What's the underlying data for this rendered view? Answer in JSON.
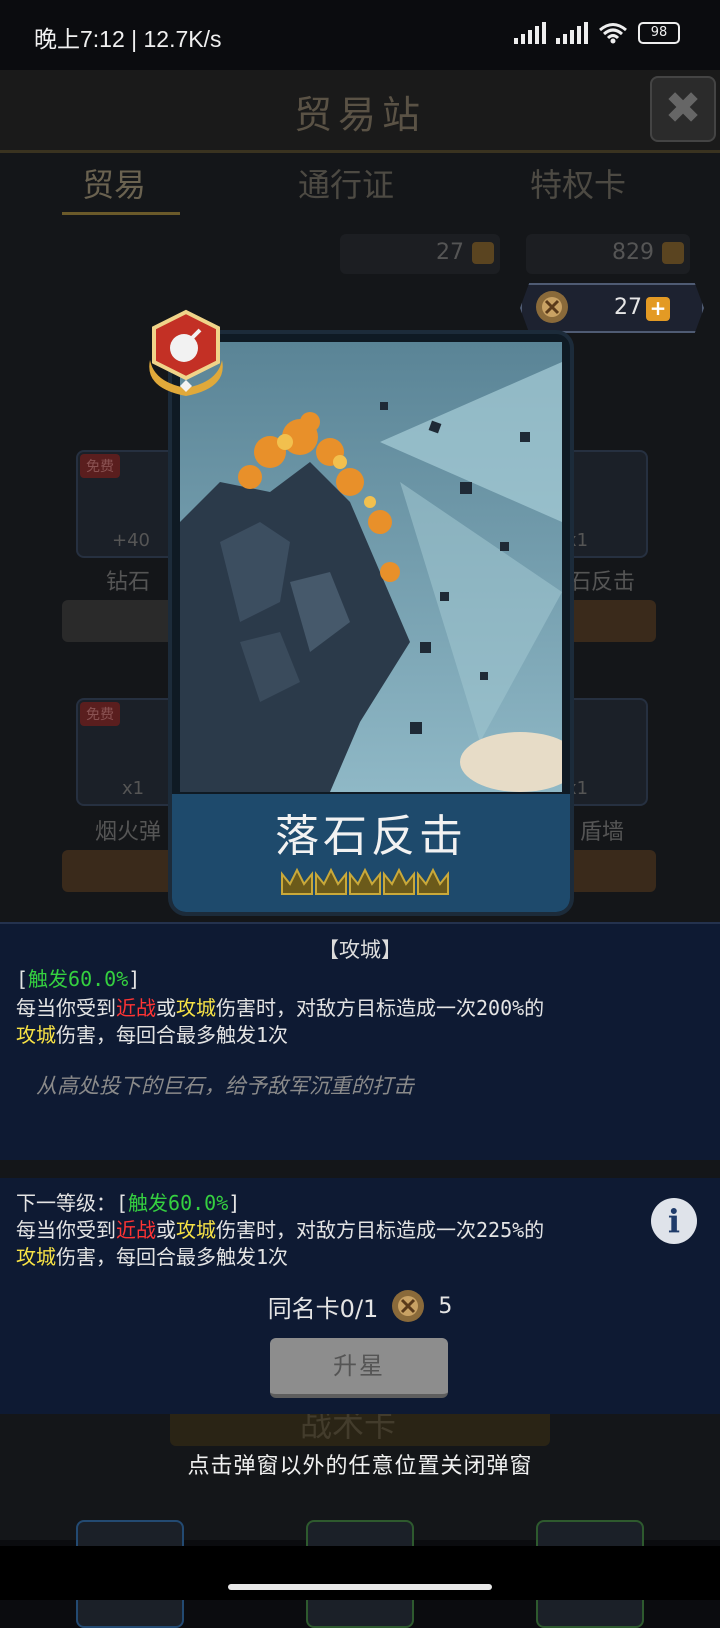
{
  "status_bar": {
    "time": "晚上7:12 | 12.7K/s",
    "battery": "98"
  },
  "background": {
    "title": "贸易站",
    "tabs": [
      "贸易",
      "通行证",
      "特权卡"
    ],
    "currency_a": "27",
    "currency_b": "829",
    "items": [
      {
        "name": "钻石",
        "qty": "+40",
        "free": "免费"
      },
      {
        "name": "石反击",
        "qty": "x1"
      },
      {
        "name": "烟火弹",
        "qty": "x1",
        "free": "免费"
      },
      {
        "name": "盾墙",
        "qty": "x1"
      }
    ],
    "tactic_card": "战术卡"
  },
  "top_currency": {
    "value": "27",
    "plus": "+"
  },
  "card": {
    "name": "落石反击",
    "stars": 5
  },
  "panel": {
    "category": "【攻城】",
    "trigger_open": "[",
    "trigger": "触发60.0%",
    "trigger_close": "]",
    "line1_a": "每当你受到",
    "line1_melee": "近战",
    "line1_b": "或",
    "line1_siege": "攻城",
    "line1_c": "伤害时，对敌方目标造成一次200%的",
    "line2_siege": "攻城",
    "line2_rest": "伤害，每回合最多触发1次",
    "flavor": "从高处投下的巨石，给予敌军沉重的打击"
  },
  "next_level": {
    "label": "下一等级：[",
    "trigger": "触发60.0%",
    "trigger_close": "]",
    "line1_a": "每当你受到",
    "line1_melee": "近战",
    "line1_b": "或",
    "line1_siege": "攻城",
    "line1_c": "伤害时，对敌方目标造成一次225%的",
    "line2_siege": "攻城",
    "line2_rest": "伤害，每回合最多触发1次"
  },
  "duplicate": {
    "label": "同名卡0/1",
    "cost": "5"
  },
  "upgrade_button": "升星",
  "close_hint": "点击弹窗以外的任意位置关闭弹窗",
  "info_icon": "i"
}
